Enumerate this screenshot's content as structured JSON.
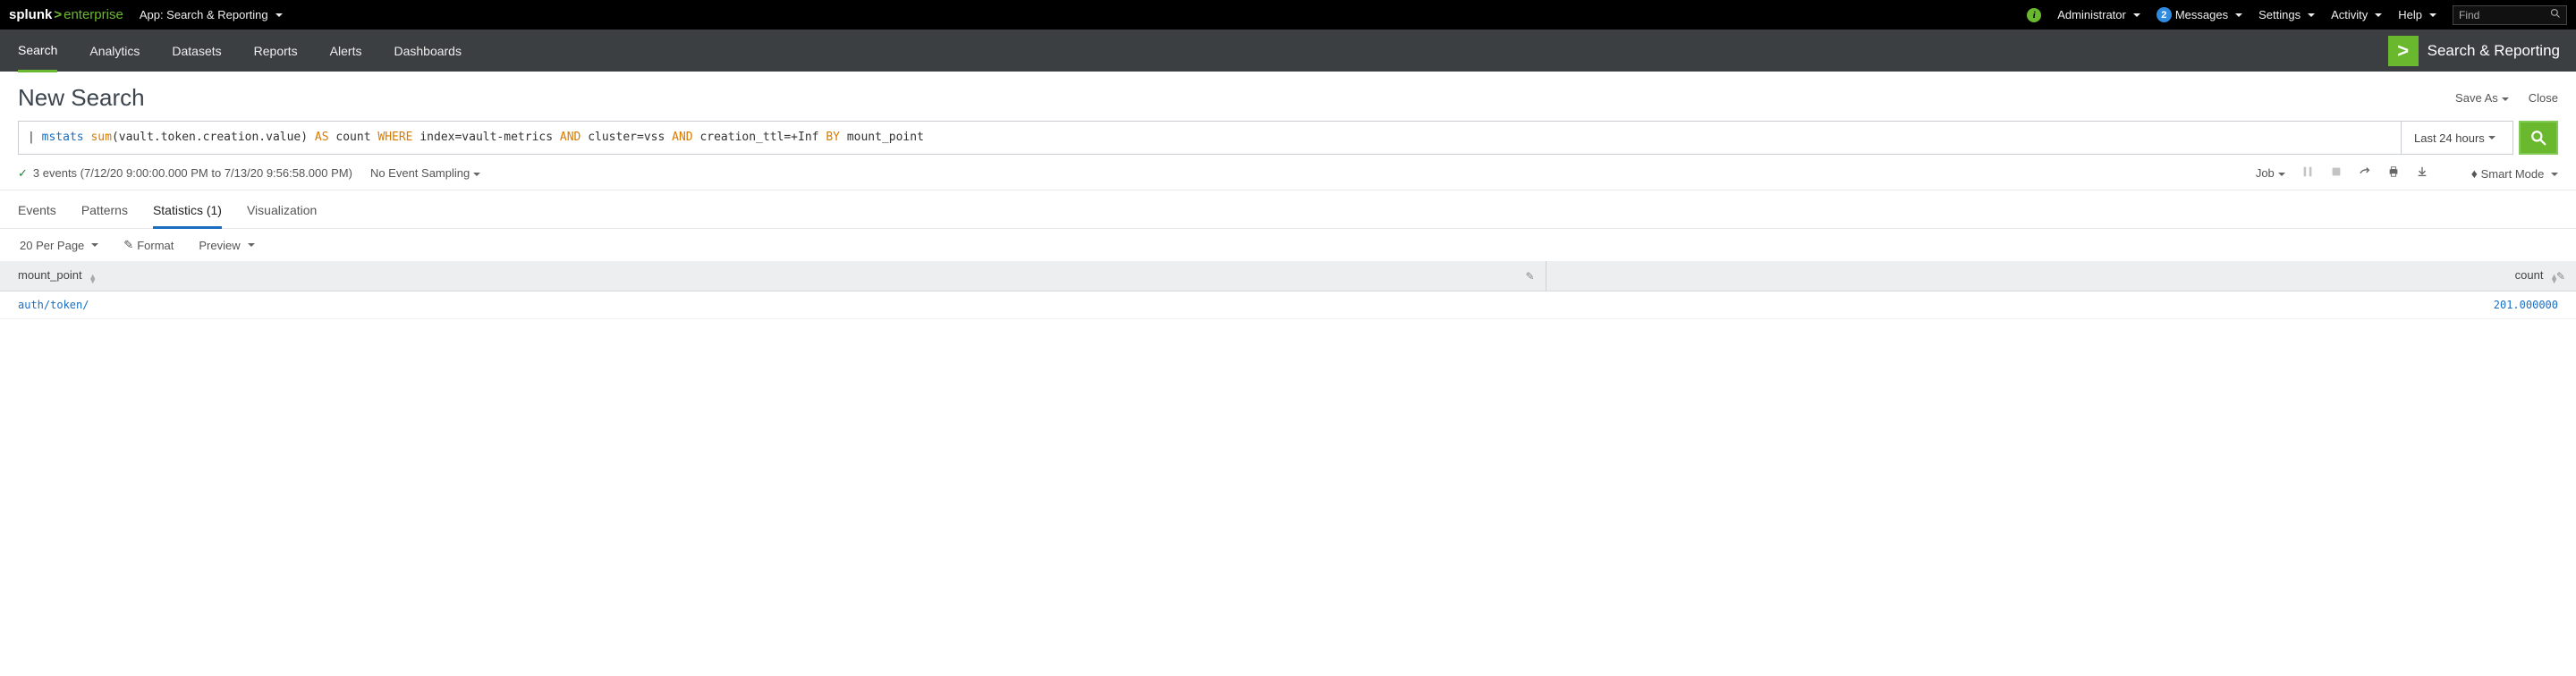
{
  "topbar": {
    "logo_splunk": "splunk",
    "logo_gt": ">",
    "logo_enterprise": "enterprise",
    "app_selector": "App: Search & Reporting",
    "info_badge_glyph": "i",
    "user": "Administrator",
    "messages_count": "2",
    "messages": "Messages",
    "settings": "Settings",
    "activity": "Activity",
    "help": "Help",
    "find_placeholder": "Find"
  },
  "navbar": {
    "items": [
      "Search",
      "Analytics",
      "Datasets",
      "Reports",
      "Alerts",
      "Dashboards"
    ],
    "app_name": "Search & Reporting",
    "app_logo_glyph": ">"
  },
  "title": {
    "text": "New Search",
    "save_as": "Save As",
    "close": "Close"
  },
  "search": {
    "pipe": "| ",
    "cmd": "mstats ",
    "func": "sum",
    "args": "(vault.token.creation.value) ",
    "as": "AS ",
    "count": "count ",
    "where": "WHERE ",
    "idx": "index=vault-metrics ",
    "and1": "AND ",
    "cluster": "cluster=vss ",
    "and2": "AND ",
    "ttl": "creation_ttl=+Inf ",
    "by": "BY ",
    "byfield": "mount_point",
    "time_picker_label": "Last 24 hours"
  },
  "info": {
    "events_text": "3 events (7/12/20 9:00:00.000 PM to 7/13/20 9:56:58.000 PM)",
    "no_event_sampling": "No Event Sampling",
    "job": "Job",
    "smart_mode": "Smart Mode"
  },
  "tabs": {
    "events": "Events",
    "patterns": "Patterns",
    "statistics": "Statistics (1)",
    "visualization": "Visualization"
  },
  "options": {
    "per_page": "20 Per Page",
    "format": "Format",
    "preview": "Preview"
  },
  "table": {
    "headers": {
      "mount_point": "mount_point",
      "count": "count"
    },
    "rows": [
      {
        "mount_point": "auth/token/",
        "count": "201.000000"
      }
    ]
  }
}
